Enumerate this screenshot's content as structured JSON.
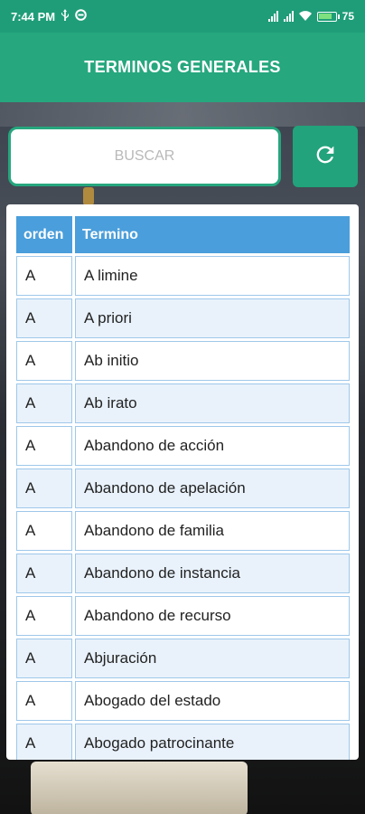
{
  "status_bar": {
    "time": "7:44 PM",
    "battery": "75"
  },
  "app_bar": {
    "title": "TERMINOS GENERALES"
  },
  "search": {
    "placeholder": "BUSCAR",
    "value": ""
  },
  "refresh_button": {
    "icon": "refresh-icon"
  },
  "table": {
    "headers": [
      "orden",
      "Termino"
    ],
    "rows": [
      {
        "orden": "A",
        "termino": "A limine"
      },
      {
        "orden": "A",
        "termino": "A priori"
      },
      {
        "orden": "A",
        "termino": "Ab initio"
      },
      {
        "orden": "A",
        "termino": "Ab irato"
      },
      {
        "orden": "A",
        "termino": "Abandono de acción"
      },
      {
        "orden": "A",
        "termino": "Abandono de apelación"
      },
      {
        "orden": "A",
        "termino": "Abandono de familia"
      },
      {
        "orden": "A",
        "termino": "Abandono de instancia"
      },
      {
        "orden": "A",
        "termino": "Abandono de recurso"
      },
      {
        "orden": "A",
        "termino": "Abjuración"
      },
      {
        "orden": "A",
        "termino": "Abogado del estado"
      },
      {
        "orden": "A",
        "termino": "Abogado patrocinante"
      }
    ]
  },
  "colors": {
    "status_bar": "#1f9d78",
    "app_bar": "#26a77e",
    "header_cell": "#4a9edb",
    "row_alt": "#e9f2fb"
  }
}
